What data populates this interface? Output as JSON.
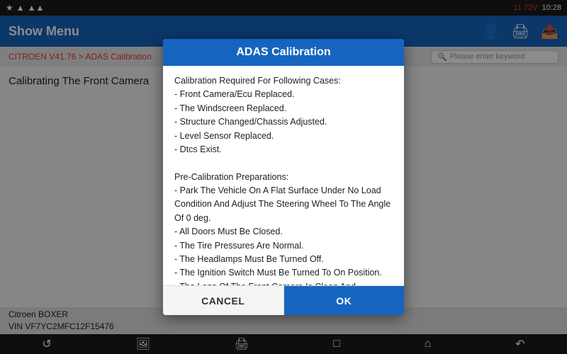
{
  "statusBar": {
    "time": "10:28",
    "battery": "11.72V",
    "batteryColor": "#e53935"
  },
  "topBar": {
    "title": "Show Menu"
  },
  "breadcrumb": {
    "text": "CITROEN V41.76 > ADAS Calibration",
    "searchPlaceholder": "Please enter keyword"
  },
  "main": {
    "label": "Calibrating The Front Camera"
  },
  "bottomBar": {
    "line1": "Citroen BOXER",
    "line2": "VIN VF7YC2MFC12F15476"
  },
  "modal": {
    "title": "ADAS Calibration",
    "body": "Calibration Required For Following Cases:\n- Front Camera/Ecu Replaced.\n- The Windscreen Replaced.\n- Structure Changed/Chassis Adjusted.\n- Level Sensor Replaced.\n- Dtcs Exist.\n\nPre-Calibration Preparations:\n- Park The Vehicle On A Flat Surface Under No Load Condition And Adjust The Steering Wheel To The Angle Of 0 deg.\n - All Doors Must Be Closed.\n- The Tire Pressures Are Normal.\n- The Headlamps Must Be Turned Off.\n- The Ignition Switch Must Be Turned To On Position.\n- The Lens Of The Front Camera Is Clean And Unblocked.\n- The Light At The Venue Should Be Bright Enough And There Are No Reflective Or Flashing Objects Around The Target.",
    "cancelLabel": "CANCEL",
    "okLabel": "OK"
  }
}
